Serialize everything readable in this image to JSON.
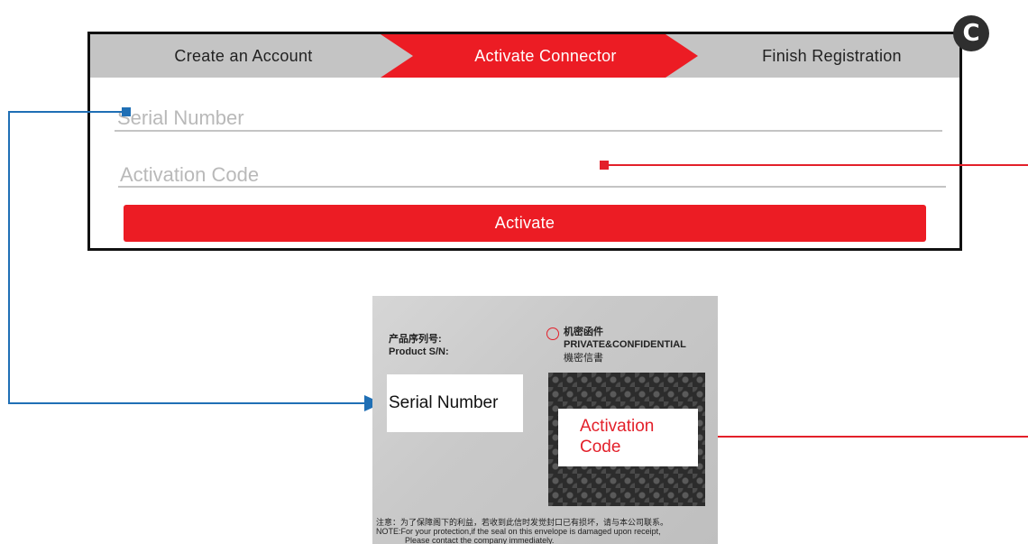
{
  "steps": {
    "step1": "Create an Account",
    "step2": "Activate Connector",
    "step3": "Finish Registration"
  },
  "badge": "C",
  "form": {
    "serial_placeholder": "Serial Number",
    "activation_placeholder": "Activation Code",
    "activate_label": "Activate"
  },
  "photo": {
    "label_cn": "产品序列号:",
    "label_en": "Product S/N:",
    "conf_cn": "机密函件",
    "conf_en": "PRIVATE&CONFIDENTIAL",
    "conf_tc": "機密信書",
    "serial_overlay": "Serial Number",
    "activation_overlay_line1": "Activation",
    "activation_overlay_line2": "Code",
    "note_cn": "注意：为了保障阁下的利益，若收到此信时发觉封口已有损坏，请与本公司联系。",
    "note_en": "NOTE:For your protection,if the seal on this envelope is damaged upon receipt,",
    "note_en2": "Please contact the company immediately."
  },
  "colors": {
    "accent_red": "#ec1c24",
    "connector_blue": "#1f6fb5",
    "step_gray": "#c4c4c4"
  }
}
